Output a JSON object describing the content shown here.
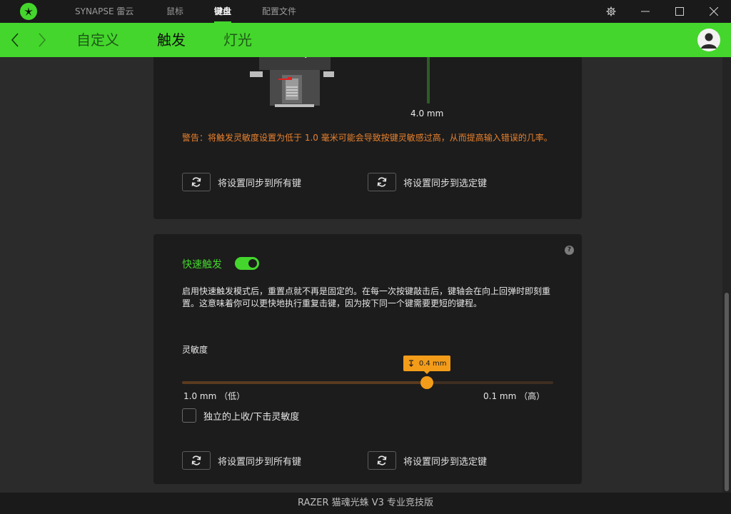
{
  "titlebar": {
    "tabs": [
      {
        "label": "SYNAPSE 雷云"
      },
      {
        "label": "鼠标"
      },
      {
        "label": "键盘"
      },
      {
        "label": "配置文件"
      }
    ],
    "active_tab": "键盘"
  },
  "subnav": {
    "tabs": [
      {
        "label": "自定义"
      },
      {
        "label": "触发"
      },
      {
        "label": "灯光"
      }
    ],
    "active_tab": "触发"
  },
  "actuation_card": {
    "distance_label": "4.0 mm",
    "warning": "警告：将触发灵敏度设置为低于 1.0 毫米可能会导致按键灵敏感过高，从而提高输入错误的几率。",
    "sync_all_label": "将设置同步到所有键",
    "sync_selected_label": "将设置同步到选定键"
  },
  "rapid_trigger_card": {
    "title": "快速触发",
    "toggle_on": true,
    "description": "启用快速触发模式后，重置点就不再是固定的。在每一次按键敲击后，键轴会在向上回弹时即刻重置。这意味着你可以更快地执行重复击键，因为按下同一个键需要更短的键程。",
    "sensitivity_label": "灵敏度",
    "slider_value_label": "0.4 mm",
    "slider_fraction": 0.66,
    "range_low": "1.0 mm （低）",
    "range_high": "0.1 mm （高）",
    "independent_label": "独立的上收/下击灵敏度",
    "independent_checked": false,
    "sync_all_label": "将设置同步到所有键",
    "sync_selected_label": "将设置同步到选定键",
    "help_icon": "?"
  },
  "footer": {
    "device_name": "RAZER 猫魂光蛛 V3 专业竞技版"
  },
  "colors": {
    "accent_green": "#44d62c",
    "warning_orange": "#e8812e",
    "slider_orange": "#f39c1a",
    "card_bg": "#1c1c1c",
    "page_bg": "#2b2b2b"
  },
  "icons": {
    "app_logo": "razer-logo-icon",
    "settings": "gear-icon",
    "minimize": "minimize-icon",
    "maximize": "maximize-icon",
    "close": "close-icon",
    "back": "chevron-left-icon",
    "forward": "chevron-right-icon",
    "profile": "avatar-icon",
    "sync": "sync-icon"
  }
}
